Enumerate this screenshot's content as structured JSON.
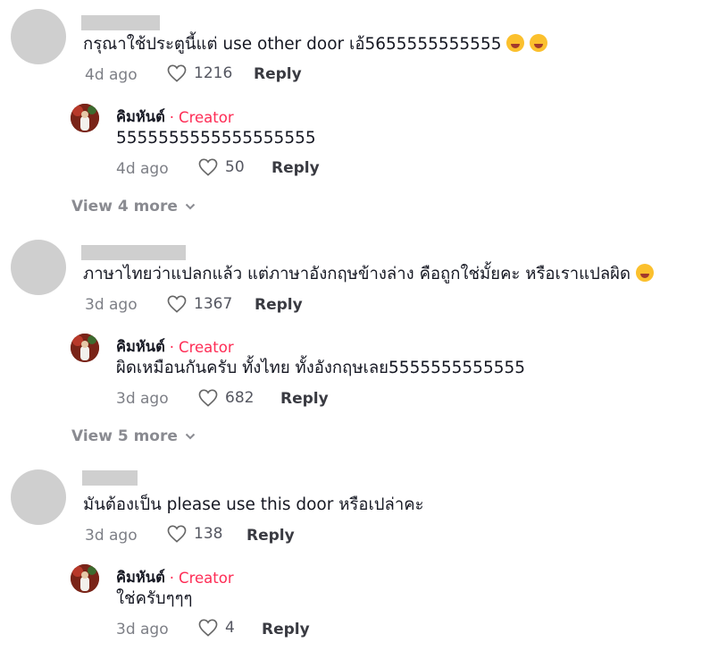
{
  "comments": [
    {
      "text": "กรุณาใช้ประตูนี้แต่ use other door เอ้5655555555555",
      "emojis": [
        "rofl-emoji",
        "rofl-emoji"
      ],
      "time": "4d ago",
      "likes": "1216",
      "reply_label": "Reply",
      "reply": {
        "author": "คิมหันต์",
        "separator": "·",
        "tag": "Creator",
        "text": "5555555555555555555",
        "time": "4d ago",
        "likes": "50",
        "reply_label": "Reply"
      },
      "view_more": "View 4 more"
    },
    {
      "text": "ภาษาไทยว่าแปลกแล้ว แต่ภาษาอังกฤษข้างล่าง คือถูกใช่มั้ยคะ หรือเราแปลผิด",
      "emojis": [
        "sweat-smile-emoji"
      ],
      "time": "3d ago",
      "likes": "1367",
      "reply_label": "Reply",
      "reply": {
        "author": "คิมหันต์",
        "separator": "·",
        "tag": "Creator",
        "text": "ผิดเหมือนกันครับ ทั้งไทย ทั้งอังกฤษเลย5555555555555",
        "time": "3d ago",
        "likes": "682",
        "reply_label": "Reply"
      },
      "view_more": "View 5 more"
    },
    {
      "text": "มันต้องเป็น please use this door หรือเปล่าคะ",
      "emojis": [],
      "time": "3d ago",
      "likes": "138",
      "reply_label": "Reply",
      "reply": {
        "author": "คิมหันต์",
        "separator": "·",
        "tag": "Creator",
        "text": "ใช่ครับๆๆๆ",
        "time": "3d ago",
        "likes": "4",
        "reply_label": "Reply"
      }
    }
  ]
}
